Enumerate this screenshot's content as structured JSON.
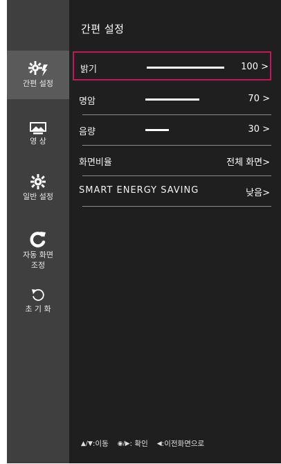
{
  "header": {
    "title": "간편 설정"
  },
  "sidebar": {
    "items": [
      {
        "label": "간편 설정",
        "icon": "quick-settings-icon",
        "active": true
      },
      {
        "label": "영 상",
        "icon": "picture-icon",
        "active": false
      },
      {
        "label": "일반 설정",
        "icon": "gear-icon",
        "active": false
      },
      {
        "label": "자동 화면\n조정",
        "icon": "auto-adjust-icon",
        "active": false
      },
      {
        "label": "초 기 화",
        "icon": "reset-icon",
        "active": false
      }
    ]
  },
  "menu": {
    "rows": [
      {
        "label": "밝기",
        "value": "100 >",
        "level_percent": 100,
        "selected": true
      },
      {
        "label": "명암",
        "value": "70 >",
        "level_percent": 70,
        "selected": false
      },
      {
        "label": "음량",
        "value": "30 >",
        "level_percent": 30,
        "selected": false
      },
      {
        "label": "화면비율",
        "value": "전체 화면>",
        "selected": false
      },
      {
        "label": "SMART ENERGY SAVING",
        "value": "낮음>",
        "selected": false
      }
    ]
  },
  "footer": {
    "move": {
      "glyph": "▲/▼",
      "label": ":이동"
    },
    "confirm": {
      "glyph": "◉/▶",
      "label": " : 확인"
    },
    "back": {
      "glyph": "◀",
      "label": " :이전화면으로"
    }
  },
  "colors": {
    "sidebar": "#3f3f3f",
    "main": "#1f1f1f",
    "selection": "#c2185b",
    "active_nav": "#5a5a5a"
  }
}
